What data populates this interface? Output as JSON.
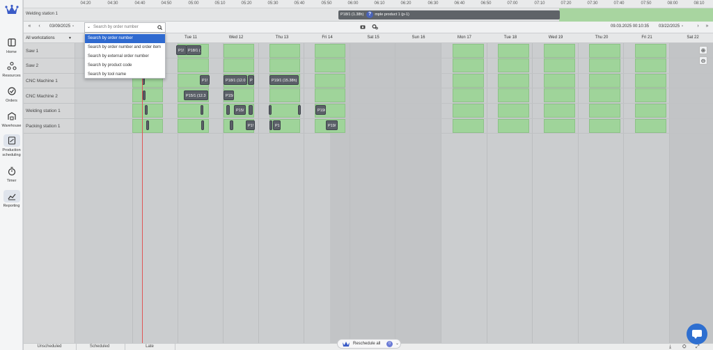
{
  "nav": {
    "items": [
      {
        "label": "Home",
        "icon": "home-icon"
      },
      {
        "label": "Resources",
        "icon": "resources-icon"
      },
      {
        "label": "Orders",
        "icon": "orders-icon"
      },
      {
        "label": "Warehouse",
        "icon": "warehouse-icon"
      },
      {
        "label": "Production scheduling",
        "icon": "production-scheduling-icon",
        "active": true
      },
      {
        "label": "Timer",
        "icon": "timer-icon"
      },
      {
        "label": "Reporting",
        "icon": "reporting-icon"
      }
    ]
  },
  "timeline": {
    "ticks": [
      "04:20",
      "04:30",
      "04:40",
      "04:50",
      "05:00",
      "05:10",
      "05:20",
      "05:30",
      "05:40",
      "05:50",
      "06:00",
      "06:10",
      "06:20",
      "06:30",
      "06:40",
      "06:50",
      "07:00",
      "07:10",
      "07:20",
      "07:30",
      "07:40",
      "07:50",
      "08:00",
      "08:10"
    ]
  },
  "mini_row": {
    "label": "Welding station 1",
    "bar_text_a": "P18/1 (1.38h)",
    "bar_text_b": "mple product 1 (p-1)",
    "help": "?"
  },
  "toolbar": {
    "start_date": "03/09/2025",
    "end_datetime": "09.03.2025 00:10:35",
    "end_date": "03/22/2025",
    "first_label": "«",
    "prev_label": "‹",
    "next_label": "›",
    "last_label": "»"
  },
  "search": {
    "placeholder": "Search by order number",
    "options": [
      "Search by order number",
      "Search by order number and order item",
      "Search by external order number",
      "Search by product code",
      "Search by tool name"
    ],
    "selected_index": 0
  },
  "workstation_filter": "All workstations",
  "days": [
    "Tue 11",
    "Wed 12",
    "Thu 13",
    "Fri 14",
    "Sat 15",
    "Sun 16",
    "Mon 17",
    "Tue 18",
    "Wed 19",
    "Thu 20",
    "Fri 21",
    "Sat 22"
  ],
  "rows": [
    "Saw 1",
    "Saw 2",
    "CNC Machine 1",
    "CNC Machine 2",
    "Welding station 1",
    "Packing station 1"
  ],
  "jobs": {
    "saw1_a": "P1!",
    "saw1_b": "P18/1 (",
    "cnc1_a": "P1!",
    "cnc1_b": "P18/1 (12.0",
    "cnc1_c": "P",
    "cnc1_d": "P19/1 (15.38h)",
    "cnc2_a": "P15/1 (12.3",
    "cnc2_b": "P15/",
    "weld_a": "P15/",
    "weld_b": "P19/",
    "pack_a": "P1!",
    "pack_b": "P1",
    "pack_c": "P19/"
  },
  "bottom": {
    "tabs": [
      "Unscheduled",
      "Scheduled",
      "Late"
    ],
    "reschedule_label": "Reschedule all",
    "reschedule_count": "0"
  },
  "colors": {
    "accent": "#2f6ad0",
    "available": "#9fd49a",
    "job": "#5b6068",
    "now_line": "#e05555"
  }
}
